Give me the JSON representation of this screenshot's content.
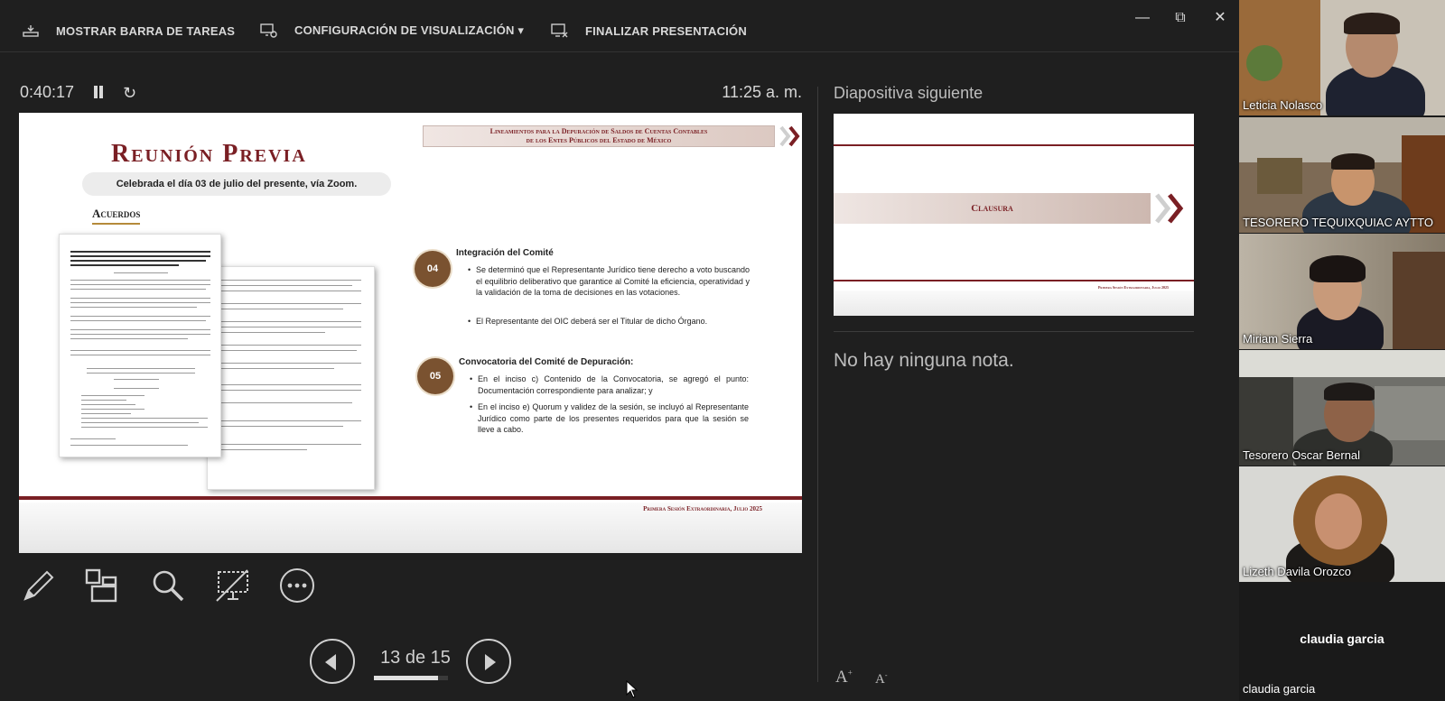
{
  "toolbar": {
    "taskbar_label": "MOSTRAR BARRA DE TAREAS",
    "display_settings_label": "CONFIGURACIÓN DE VISUALIZACIÓN ▾",
    "end_show_label": "FINALIZAR PRESENTACIÓN"
  },
  "window": {
    "minimize": "—",
    "restore": "⧉",
    "close": "✕"
  },
  "presenter": {
    "elapsed_time": "0:40:17",
    "clock": "11:25 a. m.",
    "next_slide_label": "Diapositiva siguiente",
    "notes_text": "No hay ninguna nota.",
    "page_counter": "13 de 15",
    "progress_fraction": 0.8667
  },
  "current_slide": {
    "banner_line1": "Lineamientos para la Depuración de Saldos de Cuentas Contables",
    "banner_line2": "de los Entes Públicos del Estado de México",
    "title": "Reunión Previa",
    "subtitle": "Celebrada el día 03 de julio del presente, vía Zoom.",
    "acuerdos": "Acuerdos",
    "section1_num": "04",
    "section1_title": "Integración del Comité",
    "section1_bullet1": "Se determinó que el Representante Jurídico tiene derecho a voto buscando el equilibrio deliberativo que garantice al Comité la eficiencia, operatividad y la validación de la toma de decisiones en las votaciones.",
    "section1_bullet2": "El Representante del OIC deberá ser el Titular de dicho Órgano.",
    "section2_num": "05",
    "section2_title": "Convocatoria del Comité de Depuración:",
    "section2_bullet1": "En el inciso c) Contenido de la Convocatoria, se agregó el punto: Documentación correspondiente para analizar; y",
    "section2_bullet2": "En el inciso e) Quorum y validez de la sesión, se incluyó al Representante Jurídico como parte de los presentes requeridos para que la sesión se lleve a cabo.",
    "footer": "Primera Sesión Extraordinaria, Julio 2025"
  },
  "next_slide": {
    "title": "Clausura",
    "footer": "Primera Sesión Extraordinaria, Julio 2025"
  },
  "participants": [
    {
      "name": "Leticia Nolasco"
    },
    {
      "name": "TESORERO TEQUIXQUIAC AYTTO"
    },
    {
      "name": "Miriam Sierra"
    },
    {
      "name": "Tesorero Oscar Bernal"
    },
    {
      "name": "Lizeth Davila Orozco"
    },
    {
      "name": "claudia garcia"
    }
  ],
  "icons": {
    "taskbar": "taskbar-icon",
    "display_settings": "monitor-gear-icon",
    "end_show": "monitor-x-icon",
    "pen": "pen-icon",
    "slides_grid": "see-all-slides-icon",
    "zoom": "magnifier-icon",
    "black_screen": "black-screen-icon",
    "more": "more-options-icon"
  },
  "colors": {
    "accent": "#7a1f24",
    "background": "#1f1f1f",
    "circle": "#7a5230"
  }
}
